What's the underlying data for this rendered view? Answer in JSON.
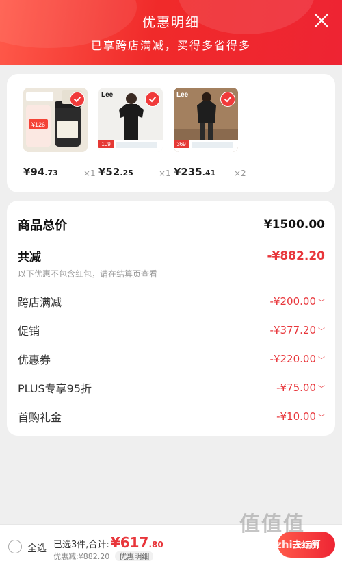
{
  "header": {
    "title": "优惠明细",
    "subtitle": "已享跨店满减，买得多省得多"
  },
  "products": [
    {
      "price_int": "¥94",
      "price_dec": ".73",
      "qty": "×1",
      "brand": "",
      "badge": "¥126"
    },
    {
      "price_int": "¥52",
      "price_dec": ".25",
      "qty": "×1",
      "brand": "Lee",
      "badge": "109"
    },
    {
      "price_int": "¥235",
      "price_dec": ".41",
      "qty": "×2",
      "brand": "Lee",
      "badge": "369"
    }
  ],
  "detail": {
    "total_label": "商品总价",
    "total_value": "¥1500.00",
    "reduce_label": "共减",
    "reduce_value": "-¥882.20",
    "note": "以下优惠不包含红包，请在结算页查看",
    "items": [
      {
        "label": "跨店满减",
        "value": "-¥200.00"
      },
      {
        "label": "促销",
        "value": "-¥377.20"
      },
      {
        "label": "优惠券",
        "value": "-¥220.00"
      },
      {
        "label": "PLUS专享95折",
        "value": "-¥75.00"
      },
      {
        "label": "首购礼金",
        "value": "-¥10.00"
      }
    ]
  },
  "bottom": {
    "select_all": "全选",
    "summary_prefix": "已选3件,合计:",
    "summary_int": "¥617",
    "summary_dec": ".80",
    "discount_text": "优惠减:¥882.20",
    "detail_tag": "优惠明细",
    "checkout": "去结算"
  },
  "watermark": {
    "text": "值值值",
    "url": "zhizhizhi.com"
  },
  "colors": {
    "accent": "#ee2433",
    "price_red": "#e8363b"
  }
}
